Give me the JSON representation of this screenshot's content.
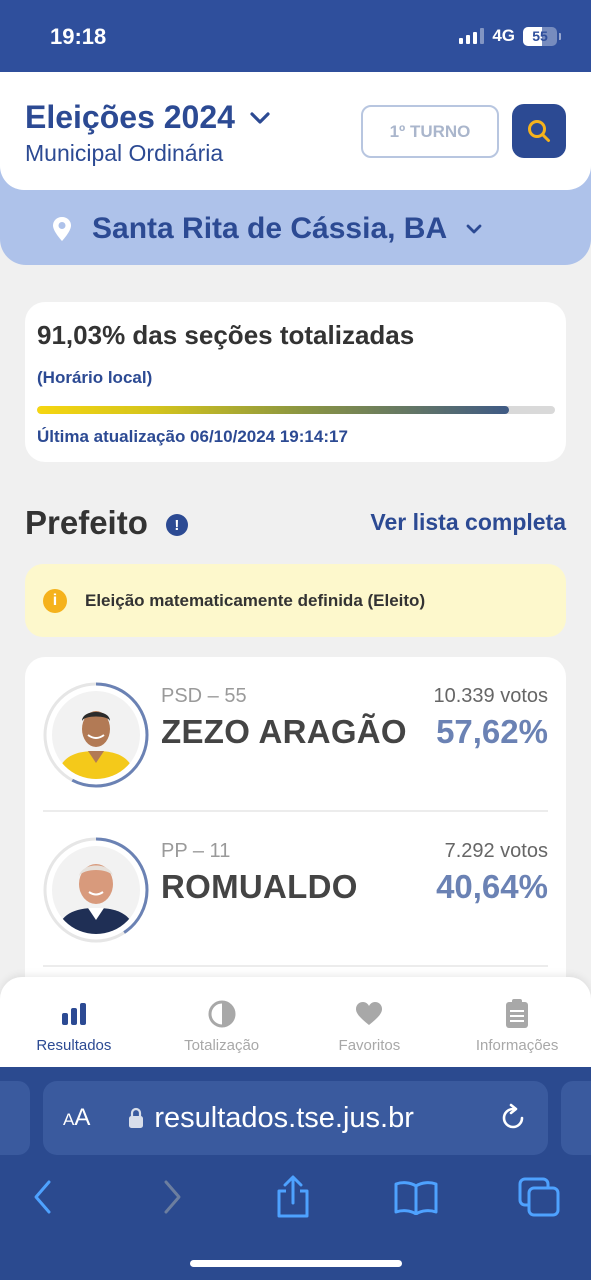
{
  "status_bar": {
    "time": "19:18",
    "network": "4G",
    "battery": "55",
    "battery_level": 0.55
  },
  "header": {
    "title": "Eleições 2024",
    "subtitle": "Municipal Ordinária",
    "turno_label": "1º TURNO",
    "icons": {
      "title_dropdown": "chevron-down-icon",
      "search": "search-icon"
    }
  },
  "location": {
    "name": "Santa Rita de Cássia, BA",
    "icons": {
      "pin": "location-pin-icon",
      "dropdown": "chevron-down-icon"
    }
  },
  "progress": {
    "title": "91,03% das seções totalizadas",
    "note": "(Horário local)",
    "value": 0.9103,
    "last_update": "Última atualização 06/10/2024 19:14:17"
  },
  "section": {
    "title": "Prefeito",
    "link": "Ver lista completa",
    "alert": "Eleição matematicamente definida (Eleito)"
  },
  "candidates": [
    {
      "party": "PSD – 55",
      "name": "ZEZO ARAGÃO",
      "votes": "10.339 votos",
      "percent": "57,62%",
      "share": 0.5762
    },
    {
      "party": "PP – 11",
      "name": "ROMUALDO",
      "votes": "7.292 votos",
      "percent": "40,64%",
      "share": 0.4064
    }
  ],
  "tabs": [
    {
      "label": "Resultados",
      "icon": "bar-chart-icon",
      "active": true
    },
    {
      "label": "Totalização",
      "icon": "pie-chart-icon",
      "active": false
    },
    {
      "label": "Favoritos",
      "icon": "heart-icon",
      "active": false
    },
    {
      "label": "Informações",
      "icon": "document-icon",
      "active": false
    }
  ],
  "browser": {
    "text_size_small": "A",
    "text_size_large": "A",
    "url": "resultados.tse.jus.br",
    "icons": [
      "lock-icon",
      "reload-icon",
      "back-icon",
      "forward-icon",
      "share-icon",
      "bookmarks-icon",
      "tabs-icon"
    ]
  },
  "colors": {
    "brand": "#2c4a93",
    "accent_band": "#aec2ea",
    "alert_bg": "#fdf8cc",
    "percent": "#6b82b4"
  }
}
